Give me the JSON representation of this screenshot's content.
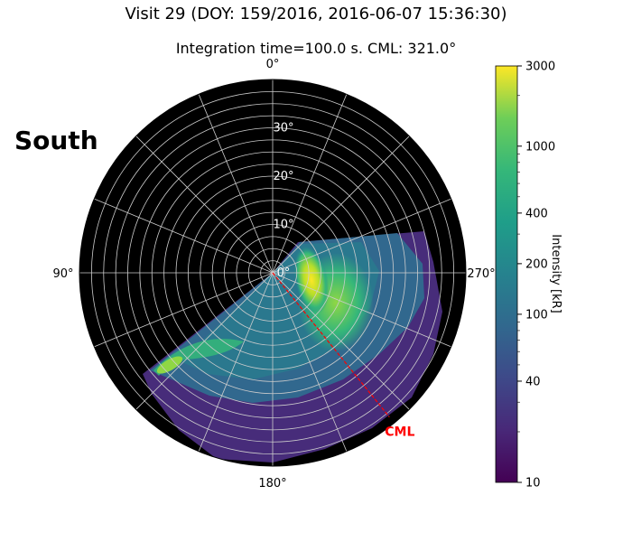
{
  "chart_data": {
    "type": "heatmap",
    "title": "Visit 29 (DOY: 159/2016, 2016-06-07 15:36:30)",
    "subtitle": "Integration time=100.0 s. CML: 321.0°",
    "hemisphere_label": "South",
    "projection": "polar",
    "radial_axis": {
      "range": [
        0,
        40
      ],
      "tick_labels": [
        "0°",
        "10°",
        "20°",
        "30°"
      ],
      "top_label": "0°"
    },
    "angle_labels": {
      "top": "0°",
      "left": "90°",
      "bottom": "180°",
      "right": "270°"
    },
    "grid": true,
    "cml": {
      "label": "CML",
      "longitude_deg": 321.0,
      "color": "#ff0000"
    },
    "colorbar": {
      "label": "Intensity [kR]",
      "scale": "log",
      "range": [
        10,
        3000
      ],
      "colormap": "viridis",
      "ticks": [
        "3000",
        "1000",
        "400",
        "200",
        "100",
        "40",
        "10"
      ]
    },
    "colors": {
      "background_disk": "#000000",
      "grid": "#cccccc",
      "cml_line": "#ff0000"
    }
  }
}
